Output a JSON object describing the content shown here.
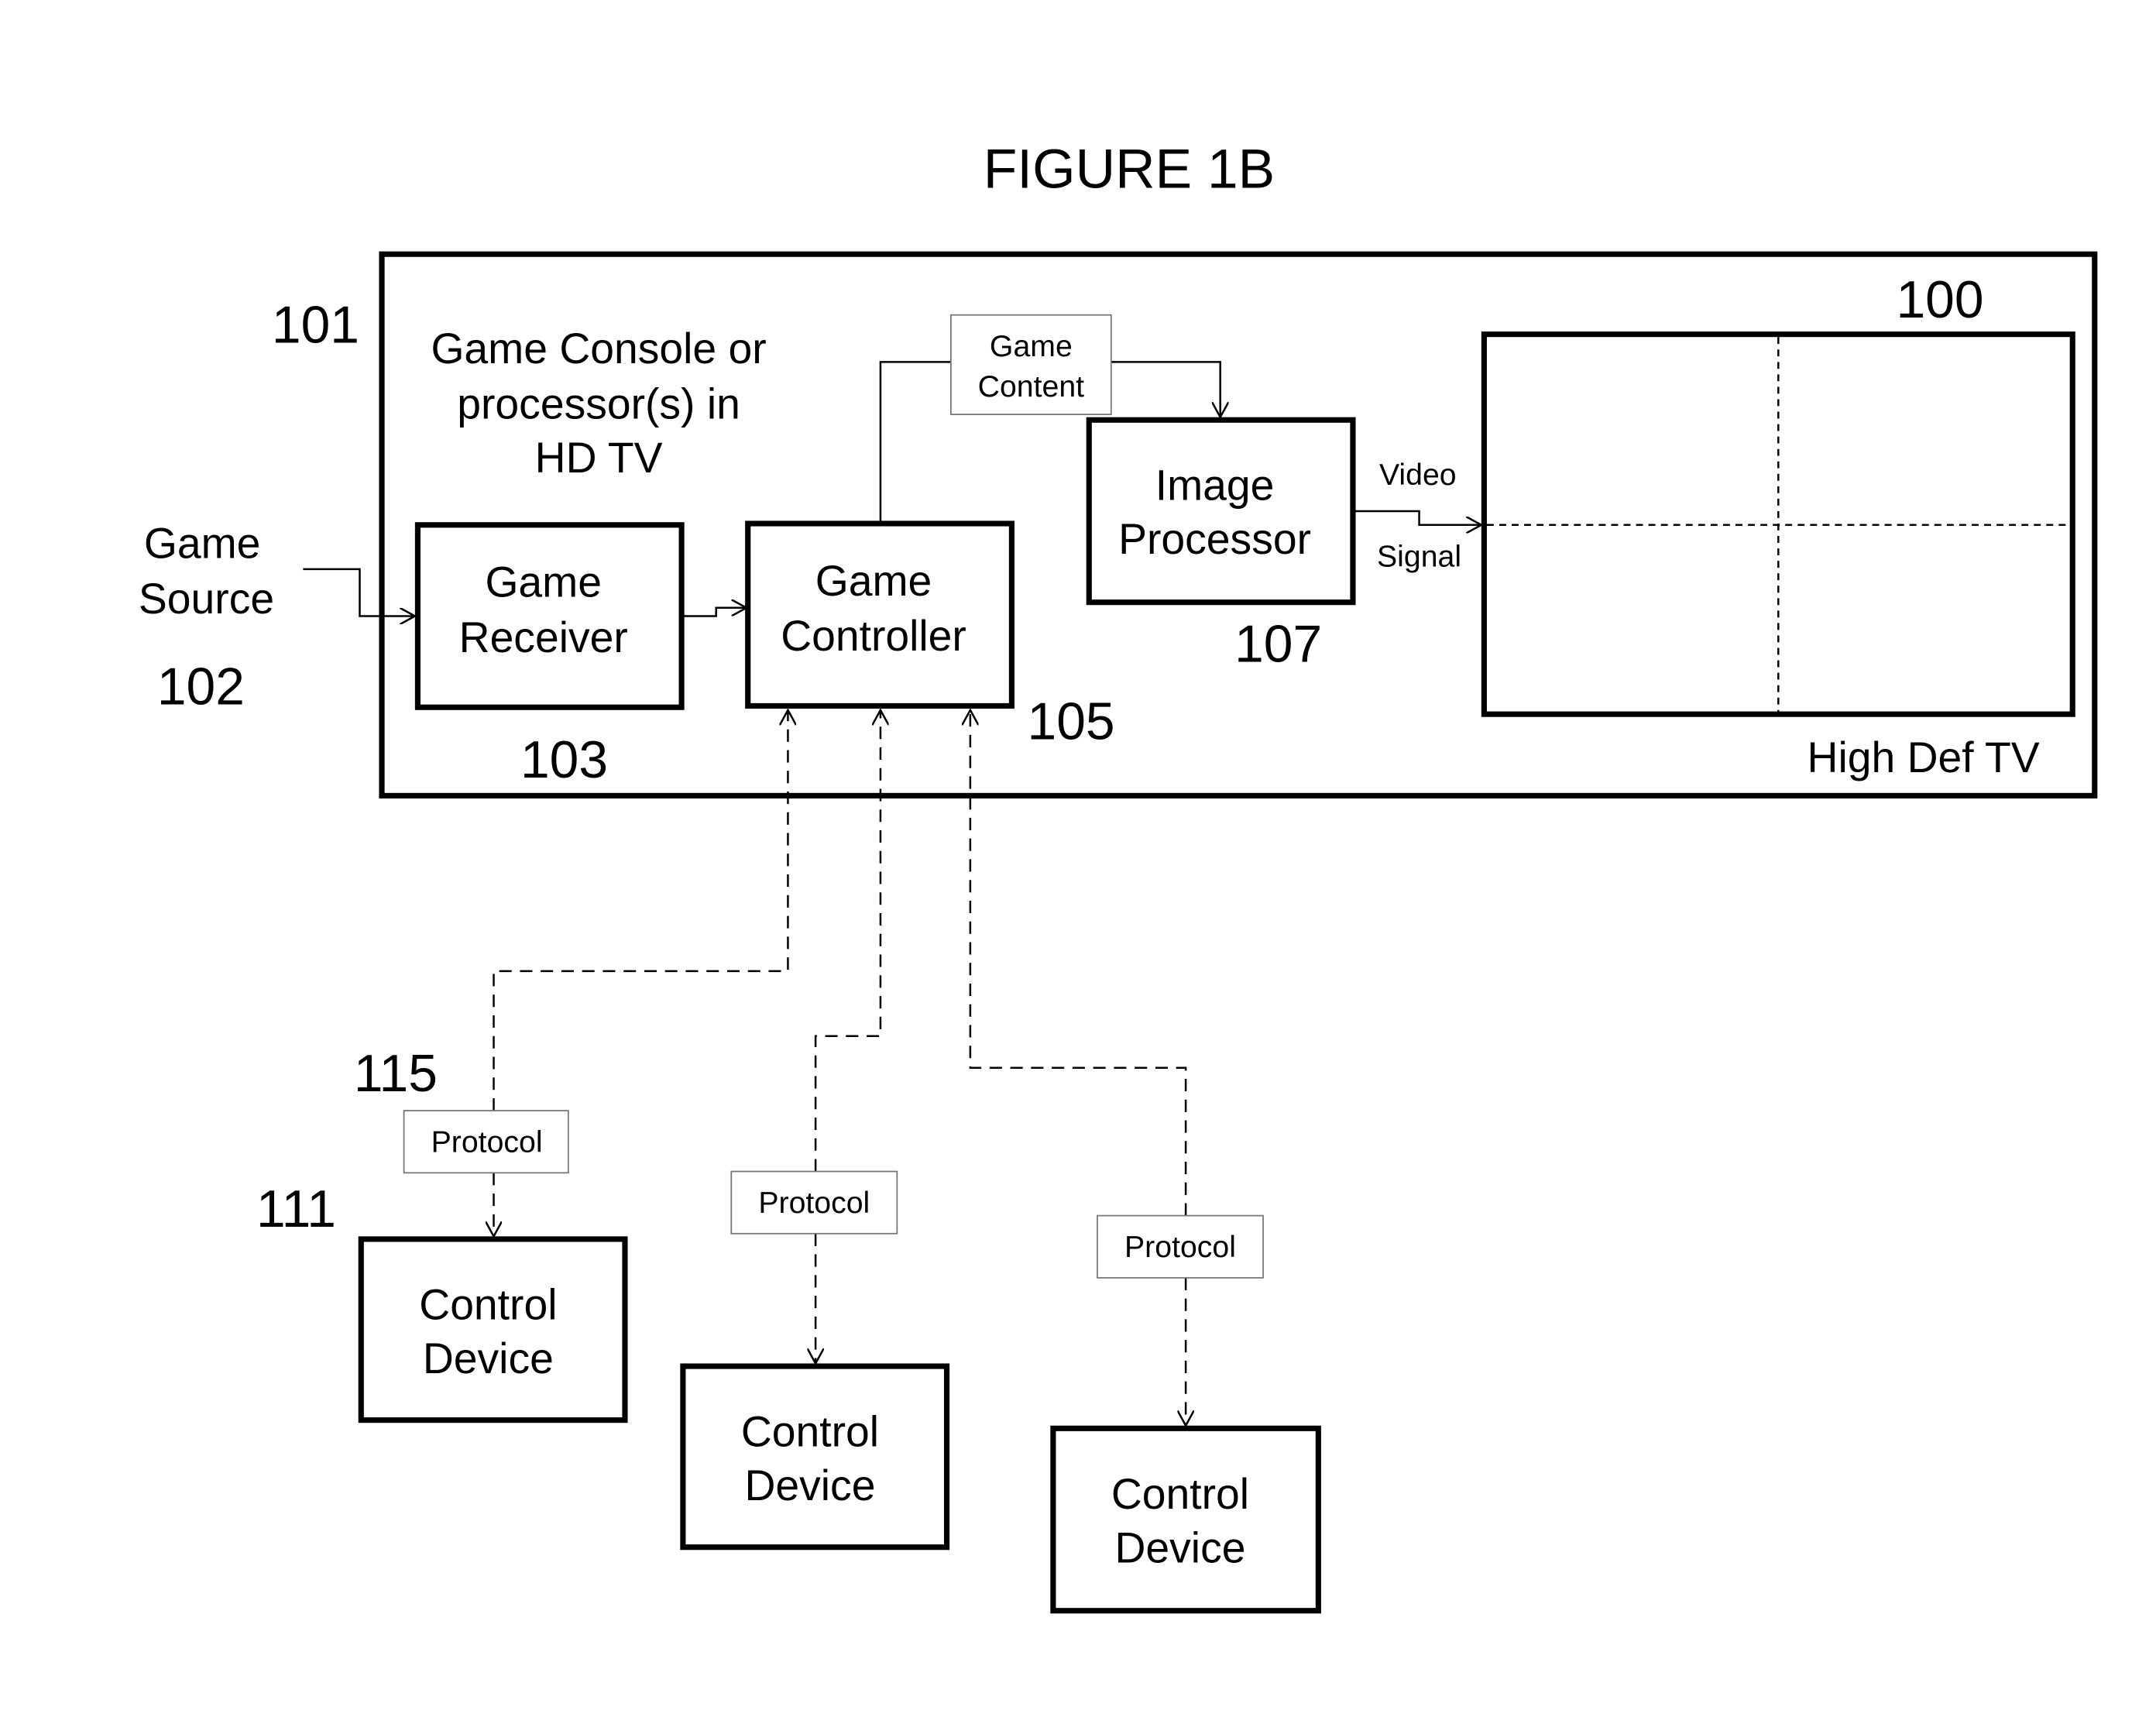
{
  "figure": {
    "title": "FIGURE 1B",
    "refs": {
      "tv": "100",
      "console": "101",
      "source": "102",
      "receiver": "103",
      "controller": "105",
      "image_processor": "107",
      "control_device": "111",
      "protocol": "115"
    },
    "console_label": [
      "Game Console or",
      "processor(s) in",
      "HD TV"
    ],
    "game_source": [
      "Game",
      "Source"
    ],
    "game_receiver": [
      "Game",
      "Receiver"
    ],
    "game_controller": [
      "Game",
      "Controller"
    ],
    "image_processor": [
      "Image",
      "Processor"
    ],
    "game_content": [
      "Game",
      "Content"
    ],
    "video_signal": [
      "Video",
      "Signal"
    ],
    "tv_label": "High Def TV",
    "protocol_label": "Protocol",
    "control_devices": [
      {
        "lines": [
          "Control",
          "Device"
        ]
      },
      {
        "lines": [
          "Control",
          "Device"
        ]
      },
      {
        "lines": [
          "Control",
          "Device"
        ]
      }
    ],
    "protocols": [
      "Protocol",
      "Protocol",
      "Protocol"
    ]
  }
}
